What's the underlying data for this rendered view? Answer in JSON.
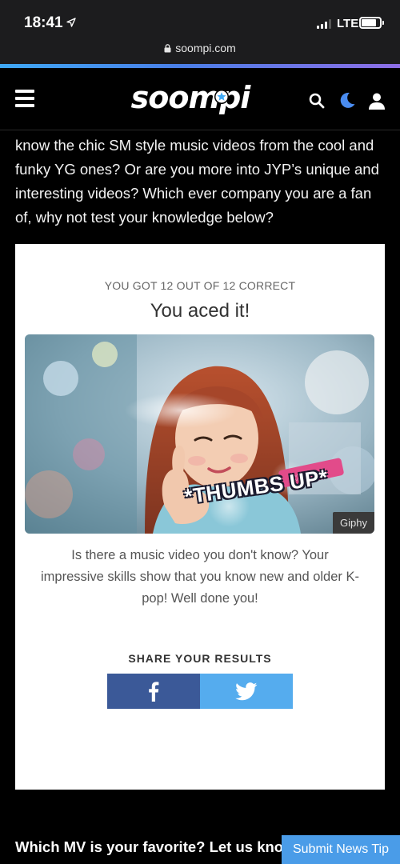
{
  "status_bar": {
    "time": "18:41",
    "network": "LTE",
    "url": "soompi.com"
  },
  "header": {
    "logo_text": "soompi",
    "icons": [
      "hamburger-menu-icon",
      "search-icon",
      "moon-icon",
      "user-icon"
    ]
  },
  "article": {
    "text": "know the chic SM style music videos from the cool and funky YG ones? Or are you more into JYP’s unique and interesting videos? Which ever company you are a fan of, why not test your knowledge below?"
  },
  "quiz_result": {
    "score": "YOU GOT 12 OUT OF 12 CORRECT",
    "title": "You aced it!",
    "gif_overlay": "*THUMBS UP*",
    "gif_caption": "Giphy",
    "description": "Is there a music video you don't know? Your impressive skills show that you know new and older K-pop! Well done you!",
    "share_label": "SHARE YOUR RESULTS"
  },
  "footer": {
    "heading": "Which MV is your favorite? Let us kno",
    "submit_tip": "Submit News Tip"
  },
  "colors": {
    "facebook": "#3b5998",
    "twitter": "#55acee",
    "accent": "#4a9ce8"
  }
}
